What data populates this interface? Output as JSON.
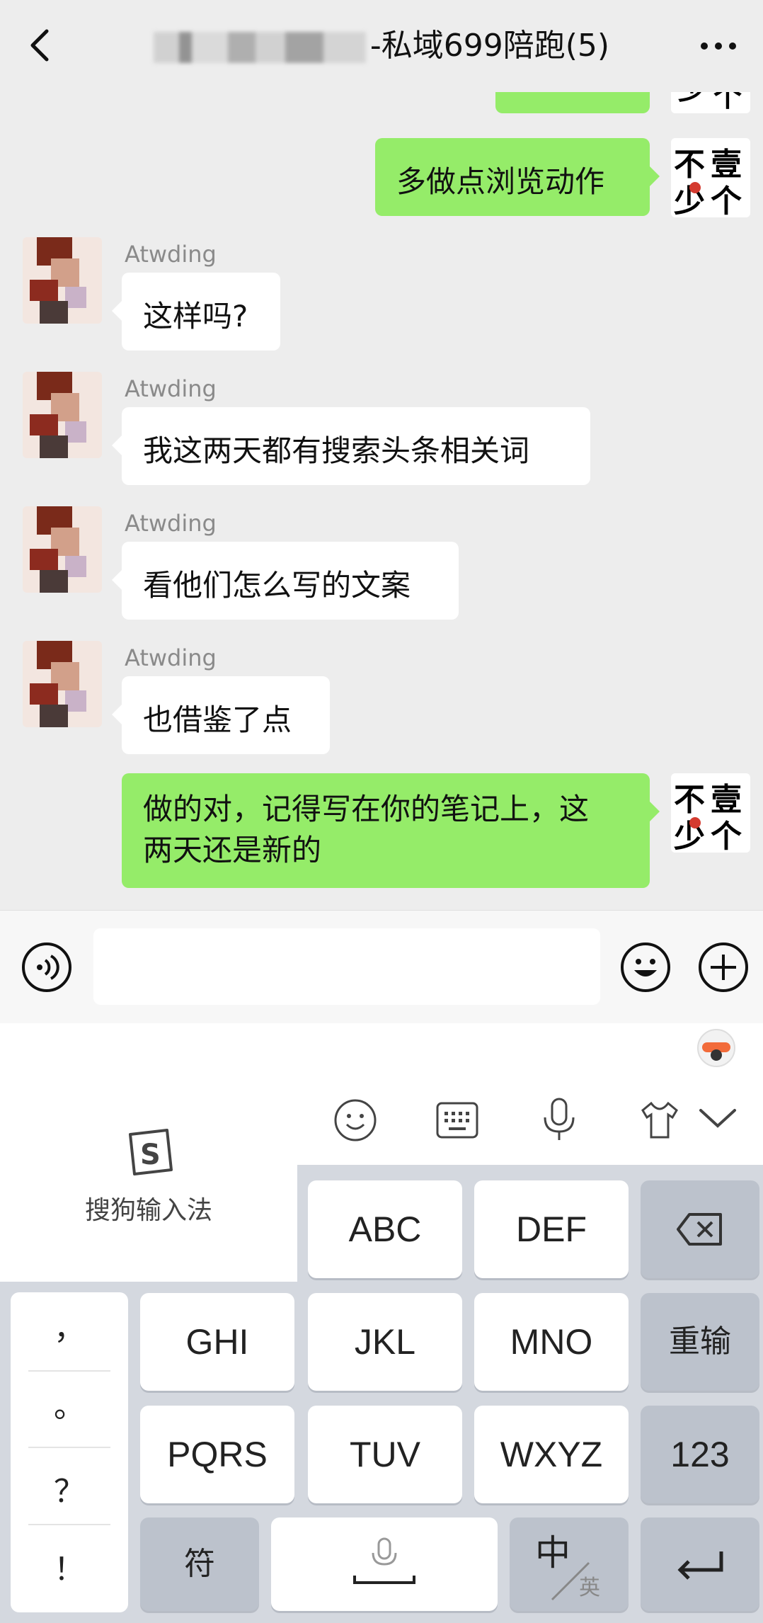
{
  "header": {
    "title_suffix": "-私域699陪跑(5)"
  },
  "messages": [
    {
      "side": "right",
      "text": "多做点浏览动作"
    },
    {
      "side": "left",
      "sender": "Atwding",
      "text": "这样吗?"
    },
    {
      "side": "left",
      "sender": "Atwding",
      "text": "我这两天都有搜索头条相关词"
    },
    {
      "side": "left",
      "sender": "Atwding",
      "text": "看他们怎么写的文案"
    },
    {
      "side": "left",
      "sender": "Atwding",
      "text": "也借鉴了点"
    },
    {
      "side": "right",
      "text_line1": "做的对，记得写在你的笔记上，这",
      "text_line2": "两天还是新的"
    }
  ],
  "my_avatar": {
    "chars": [
      "不",
      "壹",
      "少",
      "个"
    ]
  },
  "keyboard": {
    "brand_label": "搜狗输入法",
    "punctuation": [
      "，",
      "。",
      "？",
      "！"
    ],
    "keys": {
      "abc": "ABC",
      "def": "DEF",
      "ghi": "GHI",
      "jkl": "JKL",
      "mno": "MNO",
      "reenter": "重输",
      "pqrs": "PQRS",
      "tuv": "TUV",
      "wxyz": "WXYZ",
      "num": "123",
      "symbol": "符",
      "lang_main": "中",
      "lang_alt": "英"
    }
  },
  "colors": {
    "green_bubble": "#95ec69",
    "background": "#ededed",
    "keyboard_bg": "#d4d8df"
  }
}
